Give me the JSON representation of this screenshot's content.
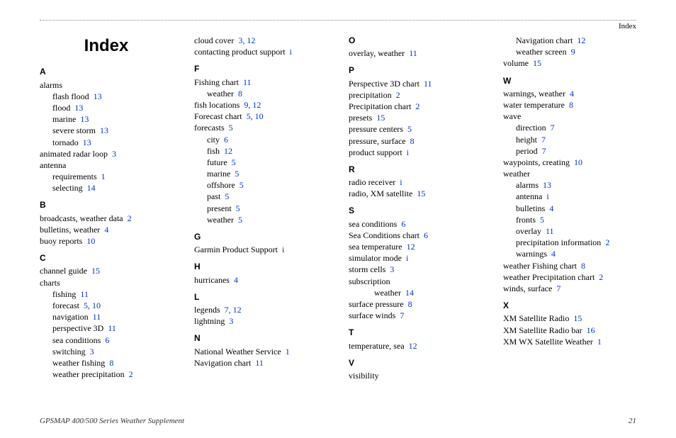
{
  "header": {
    "section_label": "Index"
  },
  "title": "Index",
  "footer": {
    "left": "GPSMAP 400/500 Series Weather Supplement",
    "right": "21"
  },
  "sections": [
    {
      "letter": "A",
      "entries": [
        {
          "term": "alarms",
          "pages": [],
          "indent": 0
        },
        {
          "term": "flash flood",
          "pages": [
            "13"
          ],
          "indent": 1
        },
        {
          "term": "flood",
          "pages": [
            "13"
          ],
          "indent": 1
        },
        {
          "term": "marine",
          "pages": [
            "13"
          ],
          "indent": 1
        },
        {
          "term": "severe storm",
          "pages": [
            "13"
          ],
          "indent": 1
        },
        {
          "term": "tornado",
          "pages": [
            "13"
          ],
          "indent": 1
        },
        {
          "term": "animated radar loop",
          "pages": [
            "3"
          ],
          "indent": 0
        },
        {
          "term": "antenna",
          "pages": [],
          "indent": 0
        },
        {
          "term": "requirements",
          "pages": [
            "1"
          ],
          "indent": 1
        },
        {
          "term": "selecting",
          "pages": [
            "14"
          ],
          "indent": 1
        }
      ]
    },
    {
      "letter": "B",
      "entries": [
        {
          "term": "broadcasts, weather data",
          "pages": [
            "2"
          ],
          "indent": 0
        },
        {
          "term": "bulletins, weather",
          "pages": [
            "4"
          ],
          "indent": 0
        },
        {
          "term": "buoy reports",
          "pages": [
            "10"
          ],
          "indent": 0
        }
      ]
    },
    {
      "letter": "C",
      "entries": [
        {
          "term": "channel guide",
          "pages": [
            "15"
          ],
          "indent": 0
        },
        {
          "term": "charts",
          "pages": [],
          "indent": 0
        },
        {
          "term": "fishing",
          "pages": [
            "11"
          ],
          "indent": 1
        },
        {
          "term": "forecast",
          "pages": [
            "5",
            "10"
          ],
          "indent": 1
        },
        {
          "term": "navigation",
          "pages": [
            "11"
          ],
          "indent": 1
        },
        {
          "term": "perspective 3D",
          "pages": [
            "11"
          ],
          "indent": 1
        },
        {
          "term": "sea conditions",
          "pages": [
            "6"
          ],
          "indent": 1
        },
        {
          "term": "switching",
          "pages": [
            "3"
          ],
          "indent": 1
        },
        {
          "term": "weather fishing",
          "pages": [
            "8"
          ],
          "indent": 1
        },
        {
          "term": "weather precipitation",
          "pages": [
            "2"
          ],
          "indent": 1
        },
        {
          "term": "cloud cover",
          "pages": [
            "3",
            "12"
          ],
          "indent": 0
        },
        {
          "term": "contacting product support",
          "pages": [
            "i"
          ],
          "indent": 0
        }
      ]
    },
    {
      "letter": "F",
      "entries": [
        {
          "term": "Fishing chart",
          "pages": [
            "11"
          ],
          "indent": 0
        },
        {
          "term": "weather",
          "pages": [
            "8"
          ],
          "indent": 1
        },
        {
          "term": "fish locations",
          "pages": [
            "9",
            "12"
          ],
          "indent": 0
        },
        {
          "term": "Forecast chart",
          "pages": [
            "5",
            "10"
          ],
          "indent": 0
        },
        {
          "term": "forecasts",
          "pages": [
            "5"
          ],
          "indent": 0
        },
        {
          "term": "city",
          "pages": [
            "6"
          ],
          "indent": 1
        },
        {
          "term": "fish",
          "pages": [
            "12"
          ],
          "indent": 1
        },
        {
          "term": "future",
          "pages": [
            "5"
          ],
          "indent": 1
        },
        {
          "term": "marine",
          "pages": [
            "5"
          ],
          "indent": 1
        },
        {
          "term": "offshore",
          "pages": [
            "5"
          ],
          "indent": 1
        },
        {
          "term": "past",
          "pages": [
            "5"
          ],
          "indent": 1
        },
        {
          "term": "present",
          "pages": [
            "5"
          ],
          "indent": 1
        },
        {
          "term": "weather",
          "pages": [
            "5"
          ],
          "indent": 1
        }
      ]
    },
    {
      "letter": "G",
      "entries": [
        {
          "term": "Garmin Product Support",
          "pages": [
            "i"
          ],
          "indent": 0
        }
      ]
    },
    {
      "letter": "H",
      "entries": [
        {
          "term": "hurricanes",
          "pages": [
            "4"
          ],
          "indent": 0
        }
      ]
    },
    {
      "letter": "L",
      "entries": [
        {
          "term": "legends",
          "pages": [
            "7",
            "12"
          ],
          "indent": 0
        },
        {
          "term": "lightning",
          "pages": [
            "3"
          ],
          "indent": 0
        }
      ]
    },
    {
      "letter": "N",
      "entries": [
        {
          "term": "National Weather Service",
          "pages": [
            "1"
          ],
          "indent": 0
        },
        {
          "term": "Navigation chart",
          "pages": [
            "11"
          ],
          "indent": 0
        }
      ]
    },
    {
      "letter": "O",
      "entries": [
        {
          "term": "overlay, weather",
          "pages": [
            "11"
          ],
          "indent": 0
        }
      ]
    },
    {
      "letter": "P",
      "entries": [
        {
          "term": "Perspective 3D chart",
          "pages": [
            "11"
          ],
          "indent": 0
        },
        {
          "term": "precipitation",
          "pages": [
            "2"
          ],
          "indent": 0
        },
        {
          "term": "Precipitation chart",
          "pages": [
            "2"
          ],
          "indent": 0
        },
        {
          "term": "presets",
          "pages": [
            "15"
          ],
          "indent": 0
        },
        {
          "term": "pressure centers",
          "pages": [
            "5"
          ],
          "indent": 0
        },
        {
          "term": "pressure, surface",
          "pages": [
            "8"
          ],
          "indent": 0
        },
        {
          "term": "product support",
          "pages": [
            "i"
          ],
          "indent": 0
        }
      ]
    },
    {
      "letter": "R",
      "entries": [
        {
          "term": "radio receiver",
          "pages": [
            "i"
          ],
          "indent": 0
        },
        {
          "term": "radio, XM satellite",
          "pages": [
            "15"
          ],
          "indent": 0
        }
      ]
    },
    {
      "letter": "S",
      "entries": [
        {
          "term": "sea conditions",
          "pages": [
            "6"
          ],
          "indent": 0
        },
        {
          "term": "Sea Conditions chart",
          "pages": [
            "6"
          ],
          "indent": 0
        },
        {
          "term": "sea temperature",
          "pages": [
            "12"
          ],
          "indent": 0
        },
        {
          "term": "simulator mode",
          "pages": [
            "i"
          ],
          "indent": 0
        },
        {
          "term": "storm cells",
          "pages": [
            "3"
          ],
          "indent": 0
        },
        {
          "term": "subscription",
          "pages": [],
          "indent": 0
        },
        {
          "term": "weather",
          "pages": [
            "14"
          ],
          "indent": 2
        },
        {
          "term": "surface pressure",
          "pages": [
            "8"
          ],
          "indent": 0
        },
        {
          "term": "surface winds",
          "pages": [
            "7"
          ],
          "indent": 0
        }
      ]
    },
    {
      "letter": "T",
      "entries": [
        {
          "term": "temperature, sea",
          "pages": [
            "12"
          ],
          "indent": 0
        }
      ]
    },
    {
      "letter": "V",
      "entries": [
        {
          "term": "visibility",
          "pages": [],
          "indent": 0
        },
        {
          "term": "Navigation chart",
          "pages": [
            "12"
          ],
          "indent": 1
        },
        {
          "term": "weather screen",
          "pages": [
            "9"
          ],
          "indent": 1
        },
        {
          "term": "volume",
          "pages": [
            "15"
          ],
          "indent": 0
        }
      ]
    },
    {
      "letter": "W",
      "entries": [
        {
          "term": "warnings, weather",
          "pages": [
            "4"
          ],
          "indent": 0
        },
        {
          "term": "water temperature",
          "pages": [
            "8"
          ],
          "indent": 0
        },
        {
          "term": "wave",
          "pages": [],
          "indent": 0
        },
        {
          "term": "direction",
          "pages": [
            "7"
          ],
          "indent": 1
        },
        {
          "term": "height",
          "pages": [
            "7"
          ],
          "indent": 1
        },
        {
          "term": "period",
          "pages": [
            "7"
          ],
          "indent": 1
        },
        {
          "term": "waypoints, creating",
          "pages": [
            "10"
          ],
          "indent": 0
        },
        {
          "term": "weather",
          "pages": [],
          "indent": 0
        },
        {
          "term": "alarms",
          "pages": [
            "13"
          ],
          "indent": 1
        },
        {
          "term": "antenna",
          "pages": [
            "i"
          ],
          "indent": 1
        },
        {
          "term": "bulletins",
          "pages": [
            "4"
          ],
          "indent": 1
        },
        {
          "term": "fronts",
          "pages": [
            "5"
          ],
          "indent": 1
        },
        {
          "term": "overlay",
          "pages": [
            "11"
          ],
          "indent": 1
        },
        {
          "term": "precipitation information",
          "pages": [
            "2"
          ],
          "indent": 1
        },
        {
          "term": "warnings",
          "pages": [
            "4"
          ],
          "indent": 1
        },
        {
          "term": "weather Fishing chart",
          "pages": [
            "8"
          ],
          "indent": 0
        },
        {
          "term": "weather Precipitation chart",
          "pages": [
            "2"
          ],
          "indent": 0
        },
        {
          "term": "winds, surface",
          "pages": [
            "7"
          ],
          "indent": 0
        }
      ]
    },
    {
      "letter": "X",
      "entries": [
        {
          "term": "XM Satellite Radio",
          "pages": [
            "15"
          ],
          "indent": 0
        },
        {
          "term": "XM Satellite Radio bar",
          "pages": [
            "16"
          ],
          "indent": 0
        },
        {
          "term": "XM WX Satellite Weather",
          "pages": [
            "1"
          ],
          "indent": 0
        }
      ]
    }
  ]
}
